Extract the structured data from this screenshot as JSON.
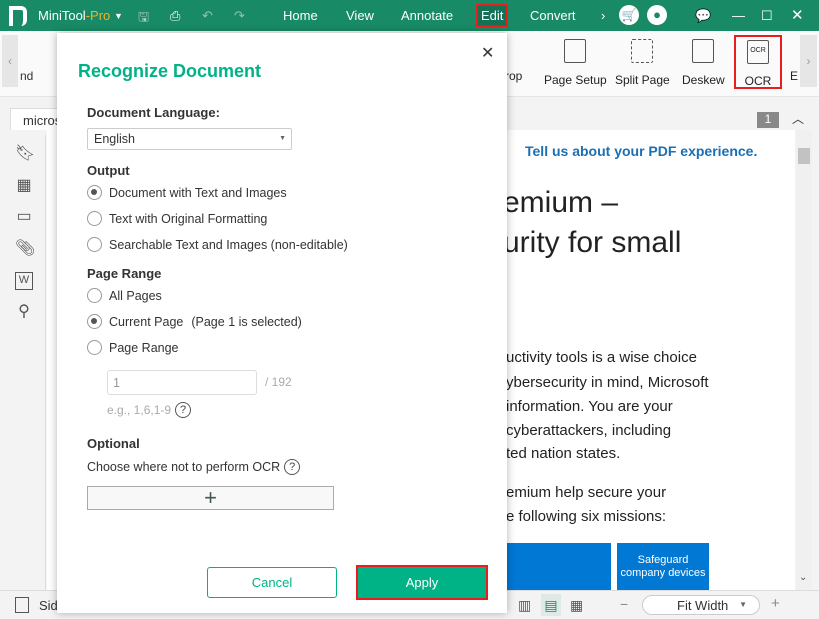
{
  "app": {
    "name": "MiniTool",
    "name_suffix": "-Pro",
    "menus": [
      "Home",
      "View",
      "Annotate",
      "Edit",
      "Convert"
    ]
  },
  "toolbar": {
    "left_partial": "nd",
    "items": [
      "rop",
      "Page Setup",
      "Split Page",
      "Deskew",
      "OCR"
    ],
    "right_partial": "E"
  },
  "tab": {
    "label": "micros",
    "page_badge": "1"
  },
  "document": {
    "feedback_link": "Tell us about your PDF experience.",
    "heading_lines": [
      "emium –",
      "urity for small"
    ],
    "paragraph1": [
      "uctivity tools is a wise choice",
      "ybersecurity in mind, Microsoft",
      "information. You are your",
      "cyberattackers, including",
      "ted nation states."
    ],
    "paragraph2": [
      "emium help secure your",
      "e following six missions:"
    ],
    "tiles": [
      "",
      "Safeguard company devices"
    ]
  },
  "status": {
    "sidebar_label": "Side",
    "zoom": "Fit Width"
  },
  "dialog": {
    "title": "Recognize Document",
    "language_label": "Document Language:",
    "language": "English",
    "output_label": "Output",
    "output_options": [
      "Document with Text and Images",
      "Text with Original Formatting",
      "Searchable Text and Images (non-editable)"
    ],
    "output_selected": 0,
    "range_label": "Page Range",
    "range_options": [
      "All Pages",
      "Current Page",
      "Page Range"
    ],
    "range_selected": 1,
    "current_page_note": "(Page 1 is selected)",
    "range_value": "1",
    "range_total": "/ 192",
    "range_hint": "e.g., 1,6,1-9",
    "optional_label": "Optional",
    "optional_text": "Choose where not to perform OCR",
    "cancel": "Cancel",
    "apply": "Apply"
  },
  "colors": {
    "brand": "#188a65",
    "accent": "#00b386",
    "highlight": "#e81e1e",
    "link": "#1a6fb5",
    "tile": "#0078d4"
  }
}
